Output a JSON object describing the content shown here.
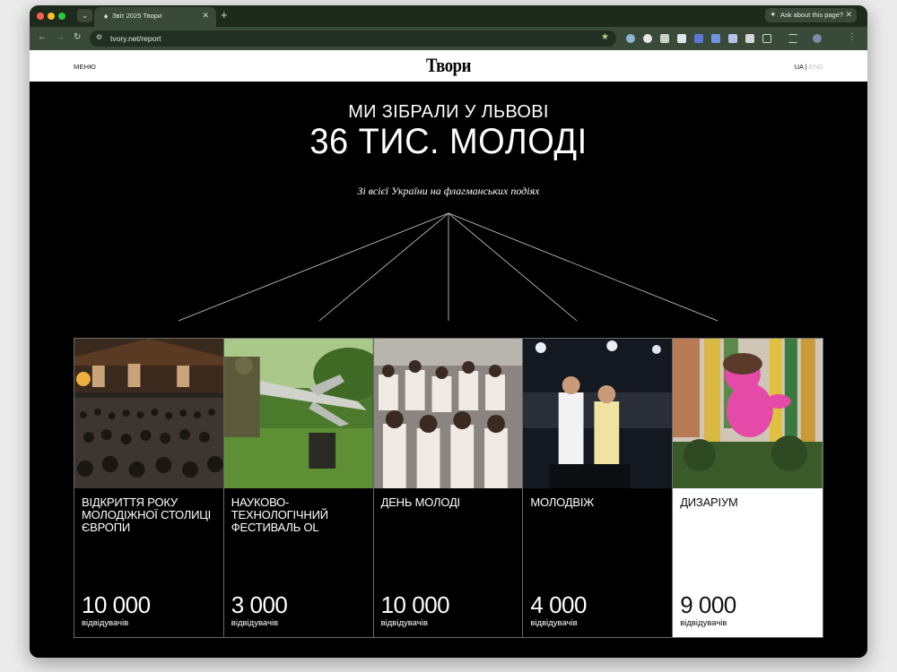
{
  "browser": {
    "tab_title": "Звіт 2025 Твори",
    "ask_label": "Ask about this page?",
    "url": "tvory.net/report"
  },
  "site": {
    "menu": "МЕНЮ",
    "logo": "Твори",
    "lang_ua": "UA",
    "lang_sep": "|",
    "lang_eng": "ENG"
  },
  "hero": {
    "line1": "МИ ЗІБРАЛИ У ЛЬВОВІ",
    "line2": "36 ТИС. МОЛОДІ",
    "subtitle": "Зі всієї України на флагманських подіях"
  },
  "events": [
    {
      "title": "ВІДКРИТТЯ РОКУ МОЛОДІЖНОЇ СТОЛИЦІ ЄВРОПИ",
      "count": "10 000",
      "unit": "відвідувачів"
    },
    {
      "title": "НАУКОВО-ТЕХНОЛОГІЧНИЙ ФЕСТИВАЛЬ OL",
      "count": "3 000",
      "unit": "відвідувачів"
    },
    {
      "title": "ДЕНЬ МОЛОДІ",
      "count": "10 000",
      "unit": "відвідувачів"
    },
    {
      "title": "МОЛОДВІЖ",
      "count": "4 000",
      "unit": "відвідувачів"
    },
    {
      "title": "ДИЗАРІУМ",
      "count": "9 000",
      "unit": "відвідувачів"
    }
  ],
  "colors": {
    "page_bg": "#000000",
    "header_bg": "#ffffff",
    "highlight_card_bg": "#ffffff",
    "browser_chrome": "#3a4a38"
  }
}
